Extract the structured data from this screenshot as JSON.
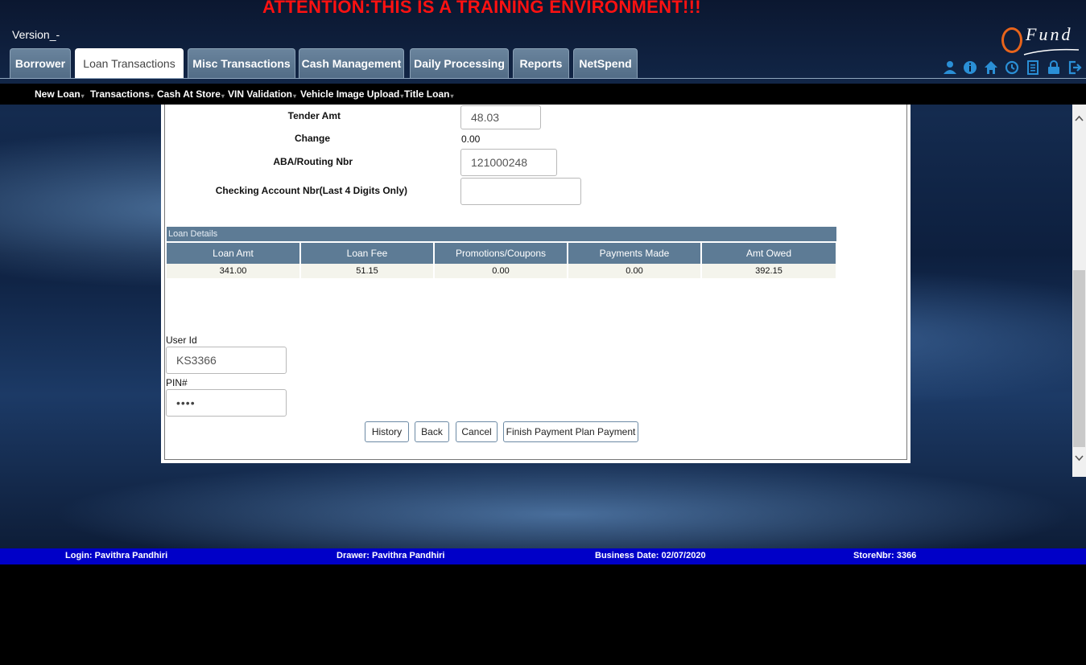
{
  "header": {
    "attention": "ATTENTION:THIS IS A TRAINING ENVIRONMENT!!!",
    "version": "Version_-",
    "logo_text": "Fund"
  },
  "tabs": [
    {
      "label": "Borrower"
    },
    {
      "label": "Loan Transactions",
      "active": true
    },
    {
      "label": "Misc Transactions"
    },
    {
      "label": "Cash Management"
    },
    {
      "label": "Daily Processing"
    },
    {
      "label": "Reports"
    },
    {
      "label": "NetSpend"
    }
  ],
  "toolbar_icons": [
    "user-icon",
    "info-icon",
    "home-icon",
    "clock-icon",
    "list-icon",
    "lock-icon",
    "logout-icon"
  ],
  "subnav": [
    {
      "label": "New Loan"
    },
    {
      "label": "Transactions"
    },
    {
      "label": "Cash At Store"
    },
    {
      "label": "VIN Validation"
    },
    {
      "label": "Vehicle Image Upload"
    },
    {
      "label": "Title Loan"
    }
  ],
  "form": {
    "tender_label": "Tender Amt",
    "tender_value": "48.03",
    "change_label": "Change",
    "change_value": "0.00",
    "aba_label": "ABA/Routing Nbr",
    "aba_value": "121000248",
    "checking_label": "Checking Account Nbr(Last 4 Digits Only)",
    "checking_value": ""
  },
  "loan_details": {
    "caption": "Loan Details",
    "headers": [
      "Loan Amt",
      "Loan Fee",
      "Promotions/Coupons",
      "Payments Made",
      "Amt Owed"
    ],
    "row": [
      "341.00",
      "51.15",
      "0.00",
      "0.00",
      "392.15"
    ]
  },
  "auth": {
    "user_label": "User Id",
    "user_value": "KS3366",
    "pin_label": "PIN#",
    "pin_value": "••••"
  },
  "buttons": {
    "history": "History",
    "back": "Back",
    "cancel": "Cancel",
    "finish": "Finish Payment Plan Payment"
  },
  "status": {
    "login": "Login: Pavithra Pandhiri",
    "drawer": "Drawer: Pavithra Pandhiri",
    "business_date": "Business Date: 02/07/2020",
    "store": "StoreNbr: 3366"
  },
  "colors": {
    "attention": "#ff1111",
    "tab_bg": "#5d7b95",
    "status_bar": "#0000c8",
    "logo_accent": "#e8641b",
    "icon_blue": "#2a8fd6"
  }
}
